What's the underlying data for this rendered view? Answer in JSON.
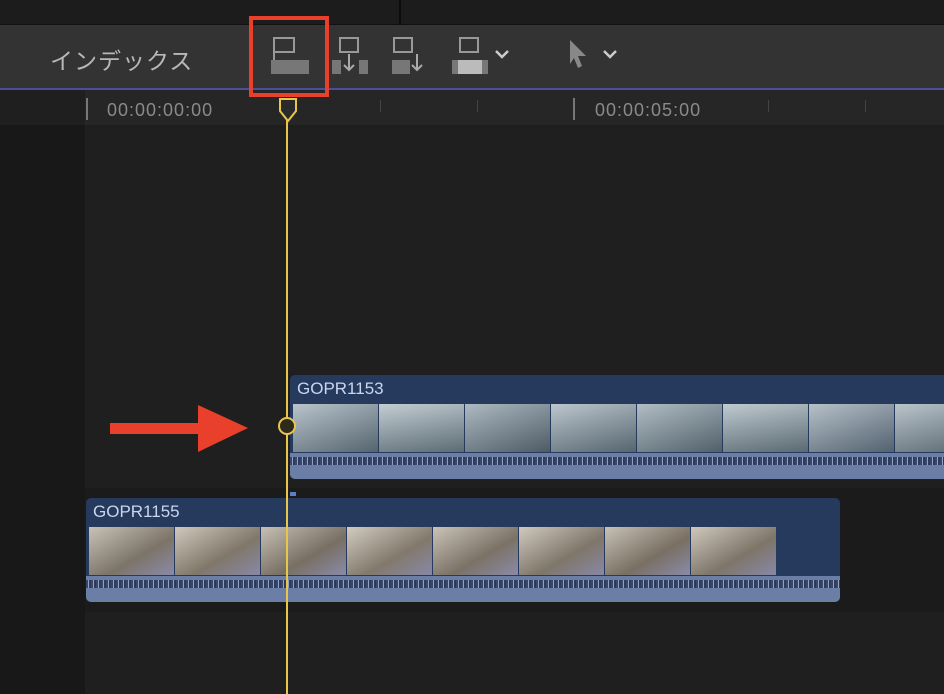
{
  "toolbar": {
    "index_label": "インデックス"
  },
  "ruler": {
    "timecodes": [
      "00:00:00:00",
      "00:00:05:00"
    ]
  },
  "clips": [
    {
      "name": "GOPR1153"
    },
    {
      "name": "GOPR1155"
    }
  ],
  "colors": {
    "playhead": "#e7c64b",
    "highlight": "#e8402a",
    "clip": "#253a5c"
  }
}
